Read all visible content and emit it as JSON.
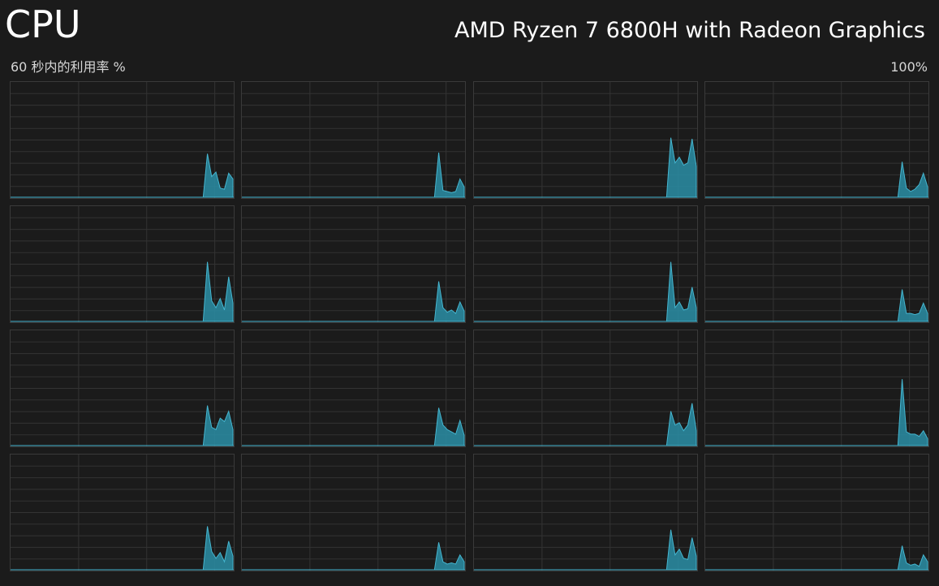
{
  "header": {
    "title": "CPU",
    "processor_name": "AMD Ryzen 7 6800H with Radeon Graphics",
    "axis_label": "60 秒内的利用率 %",
    "axis_max": "100%"
  },
  "colors": {
    "background": "#1b1b1b",
    "grid_line": "#333333",
    "border": "#3a3a3a",
    "fill": "#2a8ea6",
    "stroke": "#45b6d0"
  },
  "chart_data": {
    "type": "area",
    "x_range_seconds": [
      0,
      60
    ],
    "ylim": [
      0,
      100
    ],
    "recent_window_seconds": [
      0,
      8
    ],
    "cores": [
      {
        "index": 0,
        "recent": [
          0,
          38,
          18,
          22,
          8,
          7,
          21,
          16
        ]
      },
      {
        "index": 1,
        "recent": [
          0,
          39,
          6,
          5,
          4,
          5,
          16,
          9
        ]
      },
      {
        "index": 2,
        "recent": [
          0,
          52,
          30,
          35,
          28,
          30,
          51,
          27
        ]
      },
      {
        "index": 3,
        "recent": [
          0,
          31,
          8,
          5,
          7,
          11,
          21,
          9
        ]
      },
      {
        "index": 4,
        "recent": [
          0,
          52,
          18,
          12,
          20,
          10,
          39,
          16
        ]
      },
      {
        "index": 5,
        "recent": [
          0,
          35,
          12,
          8,
          10,
          7,
          17,
          9
        ]
      },
      {
        "index": 6,
        "recent": [
          0,
          52,
          12,
          17,
          10,
          11,
          30,
          12
        ]
      },
      {
        "index": 7,
        "recent": [
          0,
          28,
          7,
          7,
          6,
          7,
          16,
          7
        ]
      },
      {
        "index": 8,
        "recent": [
          0,
          35,
          16,
          14,
          24,
          21,
          30,
          14
        ]
      },
      {
        "index": 9,
        "recent": [
          0,
          33,
          18,
          14,
          12,
          10,
          22,
          9
        ]
      },
      {
        "index": 10,
        "recent": [
          0,
          30,
          18,
          20,
          13,
          18,
          37,
          13
        ]
      },
      {
        "index": 11,
        "recent": [
          0,
          58,
          12,
          10,
          10,
          8,
          13,
          6
        ]
      },
      {
        "index": 12,
        "recent": [
          0,
          38,
          16,
          10,
          15,
          7,
          25,
          12
        ]
      },
      {
        "index": 13,
        "recent": [
          0,
          24,
          7,
          5,
          6,
          5,
          13,
          7
        ]
      },
      {
        "index": 14,
        "recent": [
          0,
          35,
          13,
          18,
          10,
          9,
          28,
          12
        ]
      },
      {
        "index": 15,
        "recent": [
          0,
          21,
          6,
          4,
          5,
          3,
          13,
          7
        ]
      }
    ]
  }
}
